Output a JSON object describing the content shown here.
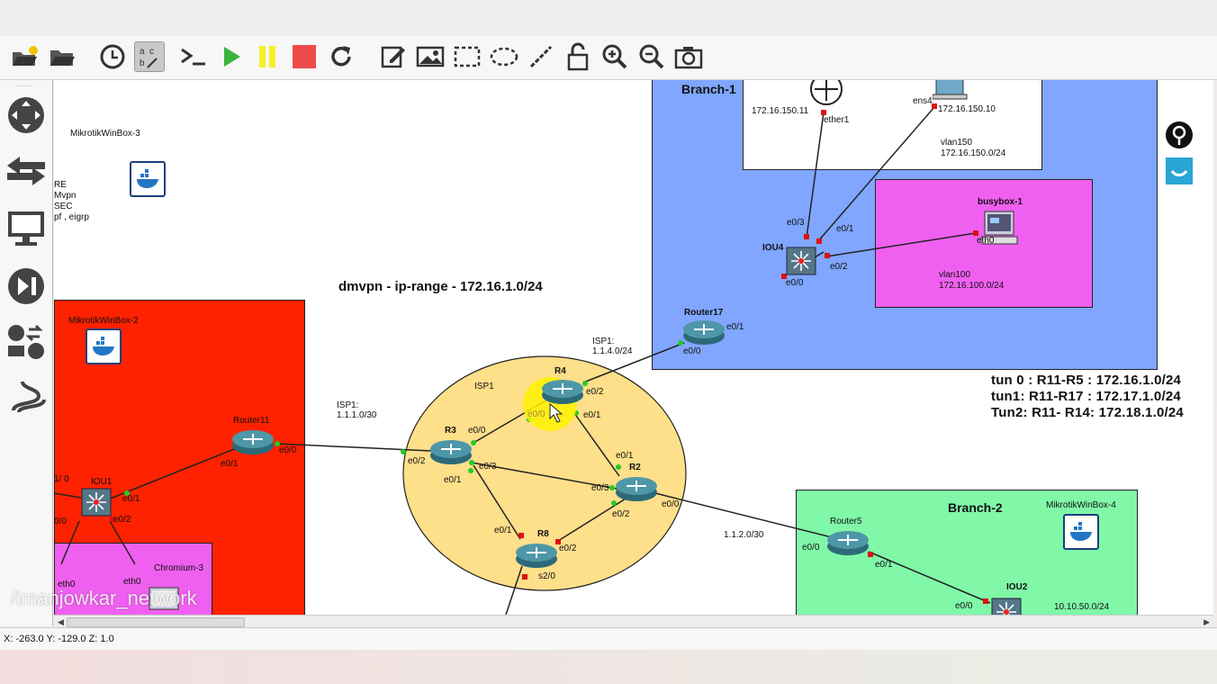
{
  "toolbar": {
    "buttons": [
      "open-project",
      "open-folder",
      "snapshot-clock",
      "show-labels",
      "console",
      "start",
      "pause",
      "stop",
      "reload",
      "add-note",
      "insert-image",
      "draw-rectangle",
      "draw-ellipse",
      "draw-line",
      "lock",
      "zoom-in",
      "zoom-out",
      "screenshot"
    ]
  },
  "leftbar": {
    "buttons": [
      "browse-routers",
      "browse-switches",
      "browse-end-devices",
      "browse-security",
      "browse-all-devices",
      "add-link"
    ]
  },
  "canvas": {
    "title_dmvpn": "dmvpn - ip-range - 172.16.1.0/24",
    "left_notes": [
      "RE",
      "Mvpn",
      "SEC",
      "pf , eigrp"
    ],
    "tunnels": [
      "tun 0 : R11-R5 : 172.16.1.0/24",
      "tun1: R11-R17 : 172.17.1.0/24",
      "Tun2: R11- R14: 172.18.1.0/24"
    ],
    "areas": {
      "branch1": "Branch-1",
      "branch2": "Branch-2",
      "isp1": "ISP1"
    },
    "nodes": {
      "mikrotik3": "MikrotikWinBox-3",
      "mikrotik2": "MikrotikWinBox-2",
      "mikrotik4": "MikrotikWinBox-4",
      "router11": "Router11",
      "iou1": "IOU1",
      "chromium3": "Chromium-3",
      "r3": "R3",
      "r4": "R4",
      "r2": "R2",
      "r8": "R8",
      "router17": "Router17",
      "iou4": "IOU4",
      "busybox1": "busybox-1",
      "router5": "Router5",
      "iou2": "IOU2"
    },
    "subnets": {
      "isp1_left": [
        "ISP1:",
        "1.1.1.0/30"
      ],
      "isp1_top": [
        "ISP1:",
        "1.1.4.0/24"
      ],
      "branch2_link": "1.1.2.0/30",
      "vlan150": [
        "vlan150",
        "172.16.150.0/24"
      ],
      "vlan100": [
        "vlan100",
        "172.16.100.0/24"
      ],
      "b2_lan": "10.10.50.0/24",
      "host1_ip": "172.16.150.11",
      "host2_ip": "172.16.150.10"
    },
    "ports": {
      "r11_e01": "e0/1",
      "r11_e00": "e0/0",
      "iou1_e01": "e0/1",
      "iou1_e02": "e0/2",
      "iou1_e10": "1/ 0",
      "iou1_e00": "0/0",
      "eth0_a": "eth0",
      "eth0_b": "eth0",
      "r3_e00": "e0/0",
      "r3_e02": "e0/2",
      "r3_e03": "e0/3",
      "r3_e01": "e0/1",
      "r4_e02": "e0/2",
      "r4_e00": "e0/0",
      "r4_e01": "e0/1",
      "r2_e01": "e0/1",
      "r2_e03": "e0/3",
      "r2_e02": "e0/2",
      "r2_e00": "e0/0",
      "r8_e01": "e0/1",
      "r8_e02": "e0/2",
      "r8_s20": "s2/0",
      "r17_e01": "e0/1",
      "r17_e00": "e0/0",
      "iou4_e03": "e0/3",
      "iou4_e01": "e0/1",
      "iou4_e02": "e0/2",
      "iou4_e00": "e0/0",
      "ether1": "ether1",
      "ens4": "ens4",
      "busy_eth0": "eth0",
      "r5_e00": "e0/0",
      "r5_e01": "e0/1",
      "iou2_e00": "e0/0"
    }
  },
  "watermark": "/imanjowkar_network",
  "status": "X: -263.0 Y: -129.0 Z: 1.0",
  "colors": {
    "red_area": "#ff2200",
    "magenta_area": "#f060f0",
    "blue_area": "#80a6ff",
    "green_area": "#80f8a8",
    "isp_ellipse": "#fedf8a"
  }
}
